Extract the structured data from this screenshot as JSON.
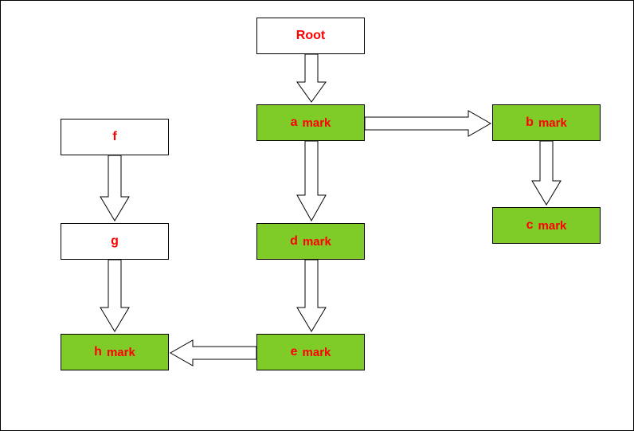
{
  "nodes": {
    "root": {
      "label": "Root",
      "mark": ""
    },
    "a": {
      "label": "a",
      "mark": "mark"
    },
    "b": {
      "label": "b",
      "mark": "mark"
    },
    "c": {
      "label": "c",
      "mark": "mark"
    },
    "d": {
      "label": "d",
      "mark": "mark"
    },
    "e": {
      "label": "e",
      "mark": "mark"
    },
    "f": {
      "label": "f",
      "mark": ""
    },
    "g": {
      "label": "g",
      "mark": ""
    },
    "h": {
      "label": "h",
      "mark": "mark"
    }
  },
  "colors": {
    "marked_bg": "#7fcc29",
    "text": "#ff0000"
  },
  "chart_data": {
    "type": "tree-diagram",
    "title": "",
    "nodes": [
      {
        "id": "Root",
        "marked": false
      },
      {
        "id": "a",
        "marked": true
      },
      {
        "id": "b",
        "marked": true
      },
      {
        "id": "c",
        "marked": true
      },
      {
        "id": "d",
        "marked": true
      },
      {
        "id": "e",
        "marked": true
      },
      {
        "id": "f",
        "marked": false
      },
      {
        "id": "g",
        "marked": false
      },
      {
        "id": "h",
        "marked": true
      }
    ],
    "edges": [
      {
        "from": "Root",
        "to": "a"
      },
      {
        "from": "a",
        "to": "b"
      },
      {
        "from": "a",
        "to": "d"
      },
      {
        "from": "b",
        "to": "c"
      },
      {
        "from": "d",
        "to": "e"
      },
      {
        "from": "e",
        "to": "h"
      },
      {
        "from": "f",
        "to": "g"
      },
      {
        "from": "g",
        "to": "h"
      }
    ]
  }
}
